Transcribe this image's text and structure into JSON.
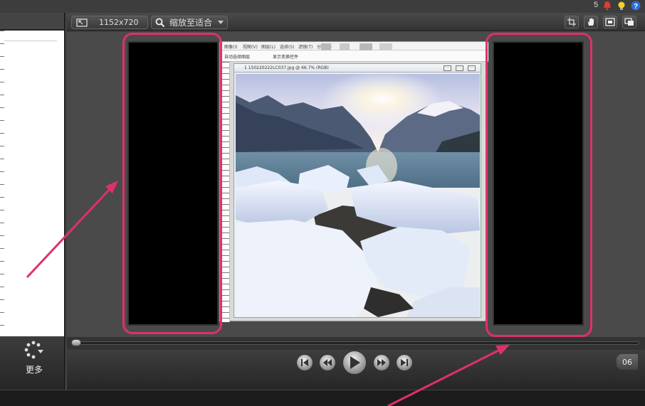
{
  "top": {
    "notification_count": "5",
    "icons": [
      "bell-icon",
      "lightbulb-icon",
      "help-icon"
    ]
  },
  "toolbar": {
    "dimensions_label": "1152x720",
    "zoom_label": "缩放至适合",
    "right_tools": [
      "crop-icon",
      "hand-pan-icon",
      "fit-screen-icon",
      "detach-preview-icon"
    ]
  },
  "left_panel": {
    "more_label": "更多"
  },
  "embedded_window": {
    "menu_items": [
      "图像(I)",
      "视图(V)",
      "图层(L)",
      "选择(S)",
      "滤镜(T)",
      "分析(A)"
    ],
    "option_left": "自动选择图层",
    "option_right": "显示变换控件",
    "doc_title": "1 150220222LC037.jpg @ 66.7% (RGB)"
  },
  "playback": {
    "buttons": [
      "skip-back-icon",
      "rewind-icon",
      "play-icon",
      "fast-forward-icon",
      "skip-forward-icon"
    ],
    "timecode": "06"
  },
  "colors": {
    "highlight": "#e0306a",
    "canvas": "#4a4a4a"
  }
}
